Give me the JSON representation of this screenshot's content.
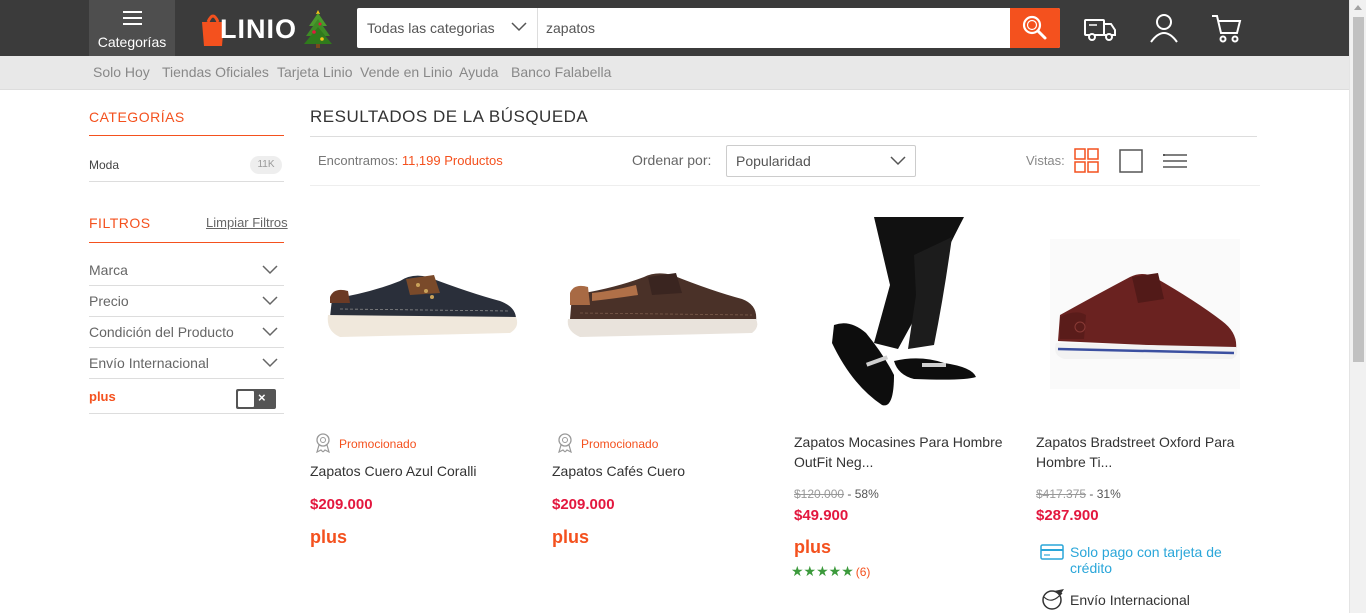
{
  "header": {
    "menu_label": "Categorías",
    "logo_text": "LINIO",
    "category_select": "Todas las categorias",
    "search_value": "zapatos",
    "colors": {
      "bar": "#3b3b3b",
      "accent": "#f4511e"
    },
    "icons": [
      "search-icon",
      "truck-icon",
      "user-icon",
      "cart-icon"
    ]
  },
  "subnav": [
    "Solo Hoy",
    "Tiendas Oficiales",
    "Tarjeta Linio",
    "Vende en Linio",
    "Ayuda",
    "Banco Falabella"
  ],
  "sidebar": {
    "categories_title": "CATEGORÍAS",
    "category": {
      "label": "Moda",
      "count": "11K"
    },
    "filters_title": "FILTROS",
    "clear_filters": "Limpiar Filtros",
    "filters": [
      "Marca",
      "Precio",
      "Condición del Producto",
      "Envío Internacional"
    ],
    "plus_label": "plus",
    "plus_toggle": "×"
  },
  "results": {
    "title": "RESULTADOS DE LA BÚSQUEDA",
    "found_prefix": "Encontramos:",
    "found_count": "11,199 Productos",
    "order_label": "Ordenar por:",
    "order_value": "Popularidad",
    "views_label": "Vistas:"
  },
  "products": [
    {
      "promo": "Promocionado",
      "name": "Zapatos Cuero Azul Coralli",
      "price": "$209.000",
      "plus": "plus"
    },
    {
      "promo": "Promocionado",
      "name": "Zapatos Cafés Cuero",
      "price": "$209.000",
      "plus": "plus"
    },
    {
      "name": "Zapatos Mocasines Para Hombre OutFit Neg...",
      "old_price": "$120.000",
      "discount": "- 58%",
      "price": "$49.900",
      "plus": "plus",
      "stars": "★★★★★",
      "rating_count": "(6)"
    },
    {
      "name": "Zapatos Bradstreet Oxford Para Hombre Ti...",
      "old_price": "$417.375",
      "discount": "- 31%",
      "price": "$287.900",
      "credit": "Solo pago con tarjeta de crédito",
      "intl": "Envío Internacional"
    }
  ]
}
